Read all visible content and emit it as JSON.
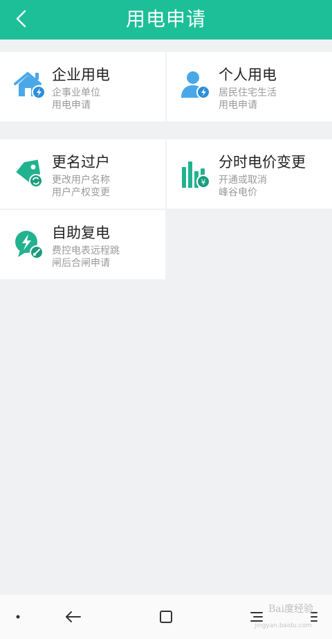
{
  "header": {
    "title": "用电申请"
  },
  "tiles": [
    {
      "title": "企业用电",
      "line1": "企事业单位",
      "line2": "用电申请"
    },
    {
      "title": "个人用电",
      "line1": "居民住宅生活",
      "line2": "用电申请"
    },
    {
      "title": "更名过户",
      "line1": "更改用户名称",
      "line2": "用户产权变更"
    },
    {
      "title": "分时电价变更",
      "line1": "开通或取消",
      "line2": "峰谷电价"
    },
    {
      "title": "自助复电",
      "line1": "费控电表远程跳",
      "line2": "闸后合闸申请"
    }
  ],
  "icons": {
    "enterprise": "house-lightning-icon",
    "personal": "person-lightning-icon",
    "transfer": "tag-refresh-icon",
    "timeofuse": "bar-chart-yen-icon",
    "restore": "bulb-lightning-icon"
  },
  "colors": {
    "accent": "#1dbf99",
    "blue": "#4aa8e8",
    "teal": "#22b28f"
  },
  "watermark": {
    "text": "Bai度经验",
    "url": "jingyan.baidu.com"
  }
}
